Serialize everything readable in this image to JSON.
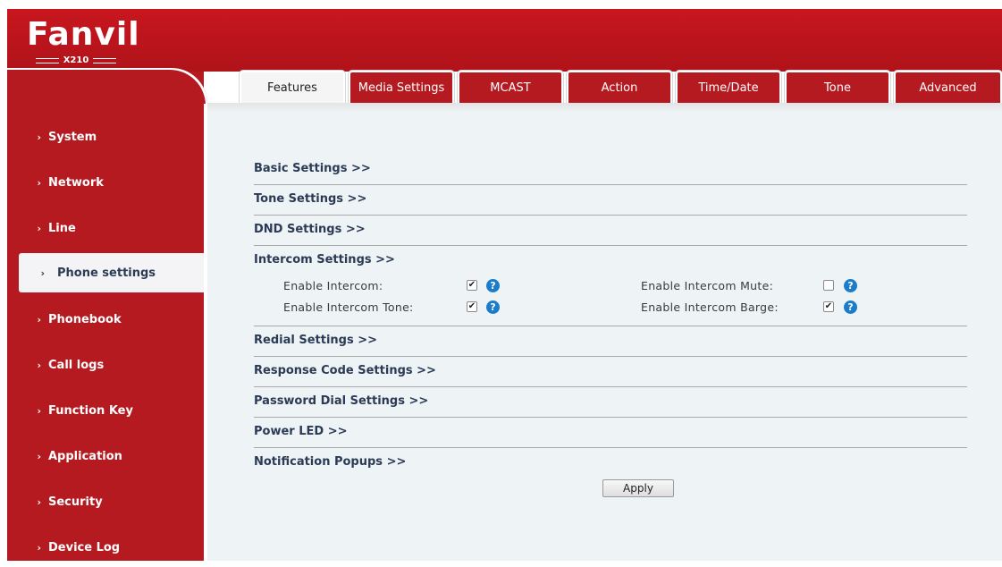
{
  "brand": {
    "logo_text": "Fanvil",
    "model": "X210"
  },
  "tabs": [
    {
      "label": "Features",
      "active": true
    },
    {
      "label": "Media Settings",
      "active": false
    },
    {
      "label": "MCAST",
      "active": false
    },
    {
      "label": "Action",
      "active": false
    },
    {
      "label": "Time/Date",
      "active": false
    },
    {
      "label": "Tone",
      "active": false
    },
    {
      "label": "Advanced",
      "active": false
    }
  ],
  "sidebar": {
    "chevron": "›",
    "items": [
      {
        "label": "System"
      },
      {
        "label": "Network"
      },
      {
        "label": "Line"
      },
      {
        "label": "Phone settings",
        "active": true
      },
      {
        "label": "Phonebook"
      },
      {
        "label": "Call logs"
      },
      {
        "label": "Function Key"
      },
      {
        "label": "Application"
      },
      {
        "label": "Security"
      },
      {
        "label": "Device Log"
      }
    ]
  },
  "sections": {
    "basic": "Basic Settings >>",
    "tone": "Tone Settings >>",
    "dnd": "DND Settings >>",
    "intercom": "Intercom Settings >>",
    "redial": "Redial Settings >>",
    "response_code": "Response Code Settings >>",
    "password_dial": "Password Dial Settings >>",
    "power_led": "Power LED >>",
    "notification": "Notification Popups >>"
  },
  "intercom": {
    "enable_intercom": {
      "label": "Enable Intercom:",
      "checked": true
    },
    "enable_intercom_tone": {
      "label": "Enable Intercom Tone:",
      "checked": true
    },
    "enable_intercom_mute": {
      "label": "Enable Intercom Mute:",
      "checked": false
    },
    "enable_intercom_barge": {
      "label": "Enable Intercom Barge:",
      "checked": true
    }
  },
  "icons": {
    "help": "?",
    "check": "✔"
  },
  "apply_label": "Apply",
  "colors": {
    "brand_red": "#b51a20",
    "help_blue": "#1d7cc9"
  }
}
